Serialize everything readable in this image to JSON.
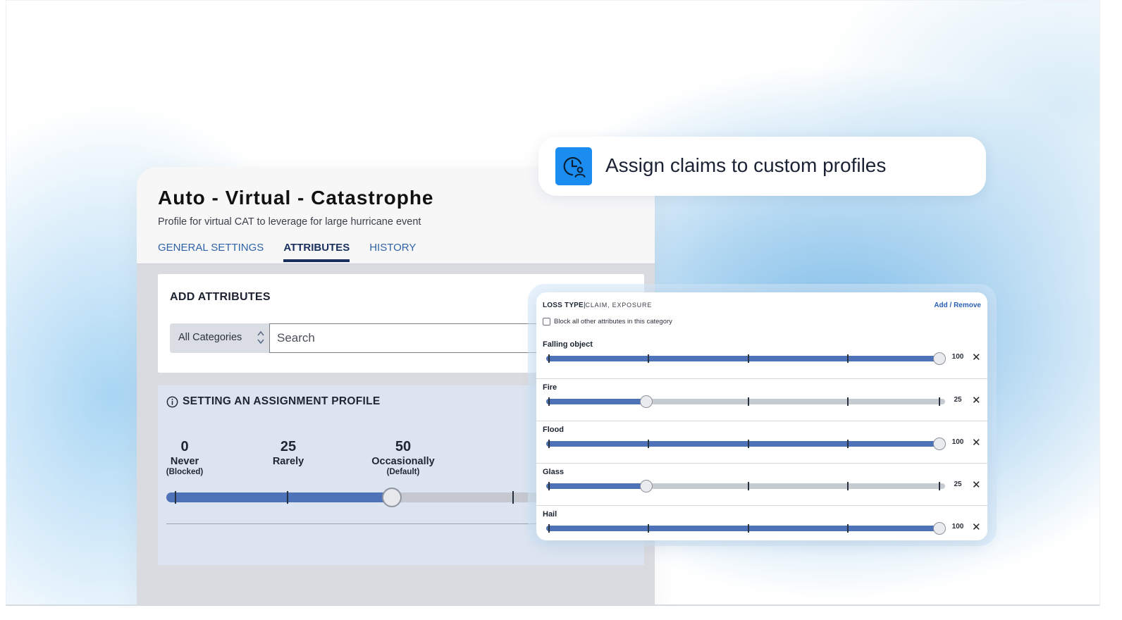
{
  "profile": {
    "title": "Auto - Virtual - Catastrophe",
    "subtitle": "Profile for virtual CAT to leverage for large hurricane event",
    "tabs": [
      {
        "label": "GENERAL SETTINGS",
        "active": false
      },
      {
        "label": "ATTRIBUTES",
        "active": true
      },
      {
        "label": "HISTORY",
        "active": false
      }
    ]
  },
  "add_attributes": {
    "title": "ADD ATTRIBUTES",
    "category_value": "All Categories",
    "search_placeholder": "Search"
  },
  "assignment": {
    "title": "SETTING AN ASSIGNMENT PROFILE",
    "levels": [
      {
        "value": "0",
        "name": "Never",
        "note": "(Blocked)"
      },
      {
        "value": "25",
        "name": "Rarely",
        "note": ""
      },
      {
        "value": "50",
        "name": "Occasionally",
        "note": "(Default)"
      }
    ],
    "slider_value": 50
  },
  "callout": {
    "text": "Assign claims to custom profiles",
    "icon": "clock-user-icon",
    "accent": "#1b8cf0"
  },
  "loss_type": {
    "title": "LOSS TYPE",
    "subtitle": "CLAIM, EXPOSURE",
    "action": "Add / Remove",
    "block_label": "Block all other attributes in this category",
    "block_checked": false,
    "rows": [
      {
        "name": "Falling object",
        "value": 100
      },
      {
        "name": "Fire",
        "value": 25
      },
      {
        "name": "Flood",
        "value": 100
      },
      {
        "name": "Glass",
        "value": 25
      },
      {
        "name": "Hail",
        "value": 100
      }
    ]
  },
  "colors": {
    "slider_fill": "#4d72b8",
    "link": "#2a5fb3",
    "tab_active": "#1a2f5e"
  }
}
